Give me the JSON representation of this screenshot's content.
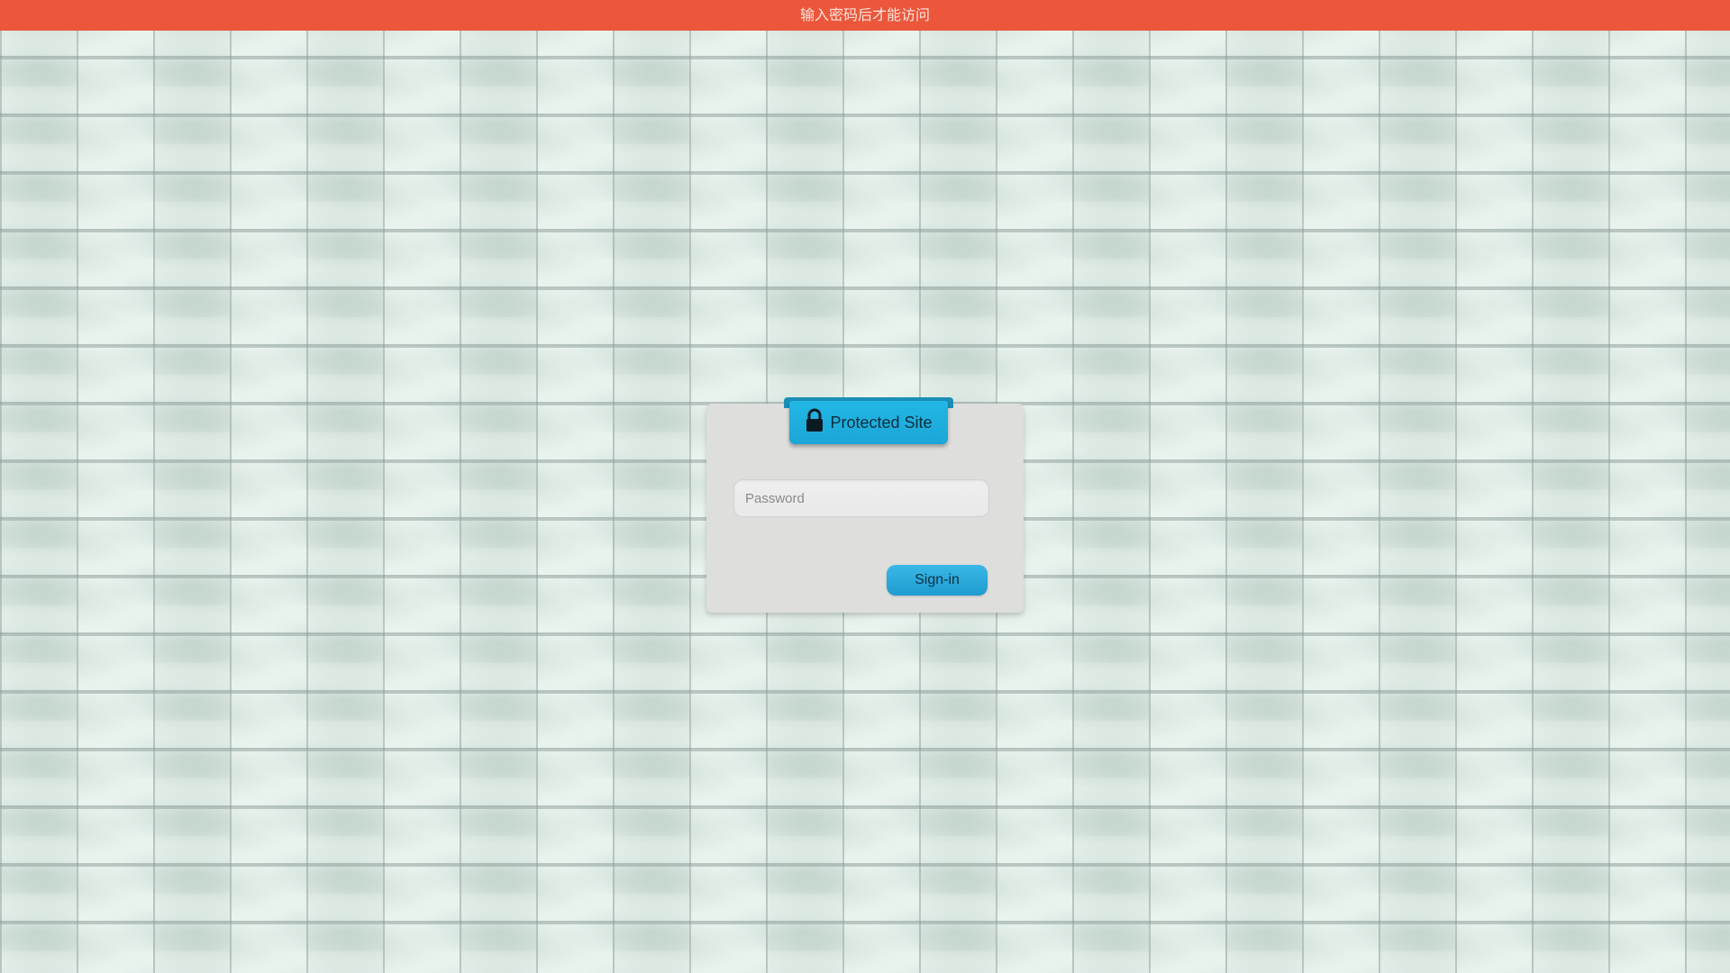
{
  "banner": {
    "text": "输入密码后才能访问",
    "color": "#ec563b"
  },
  "login": {
    "title": "Protected Site",
    "title_icon": "lock-icon",
    "password_placeholder": "Password",
    "password_value": "",
    "signin_label": "Sign-in",
    "accent_color": "#1ca6d6"
  },
  "background": {
    "pattern": "brick-wall",
    "base_color": "#e9f3ee"
  }
}
